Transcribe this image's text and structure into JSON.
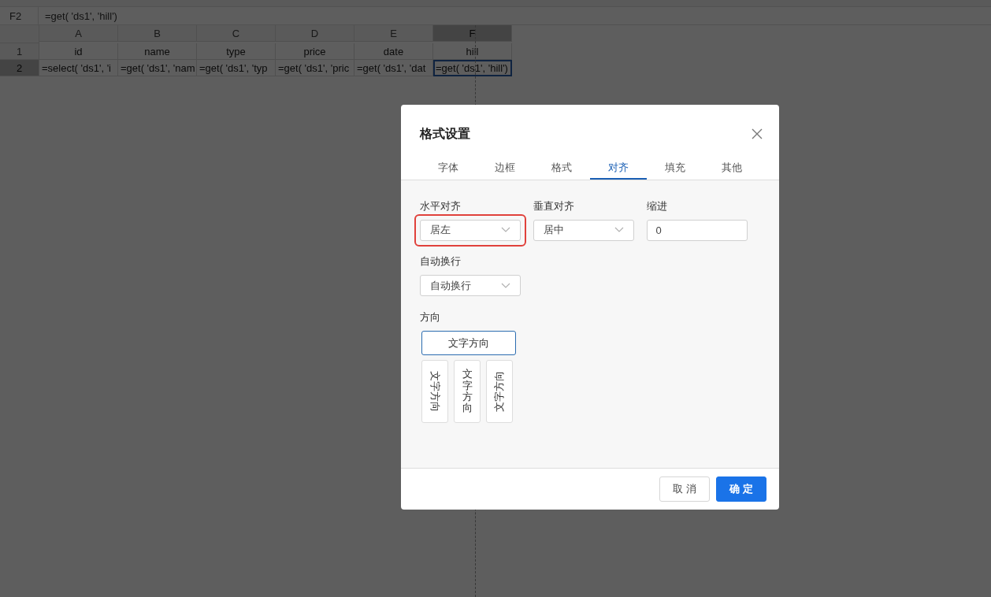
{
  "formula_bar": {
    "cell_ref": "F2",
    "formula": "=get( 'ds1', 'hill')"
  },
  "sheet": {
    "columns": [
      {
        "label": "A",
        "selected": false
      },
      {
        "label": "B",
        "selected": false
      },
      {
        "label": "C",
        "selected": false
      },
      {
        "label": "D",
        "selected": false
      },
      {
        "label": "E",
        "selected": false
      },
      {
        "label": "F",
        "selected": true
      }
    ],
    "rows": [
      {
        "label": "1",
        "selected": false,
        "cells": [
          {
            "text": "id",
            "selected": false
          },
          {
            "text": "name",
            "selected": false
          },
          {
            "text": "type",
            "selected": false
          },
          {
            "text": "price",
            "selected": false
          },
          {
            "text": "date",
            "selected": false
          },
          {
            "text": "hill",
            "selected": false
          }
        ]
      },
      {
        "label": "2",
        "selected": true,
        "cells": [
          {
            "text": "=select( 'ds1', 'i",
            "selected": false
          },
          {
            "text": "=get( 'ds1', 'nam",
            "selected": false
          },
          {
            "text": "=get( 'ds1', 'typ",
            "selected": false
          },
          {
            "text": "=get( 'ds1', 'pric",
            "selected": false
          },
          {
            "text": "=get( 'ds1', 'dat",
            "selected": false
          },
          {
            "text": "=get( 'ds1', 'hill')",
            "selected": true
          }
        ]
      }
    ]
  },
  "dialog": {
    "title": "格式设置",
    "tabs": [
      {
        "label": "字体",
        "selected": false
      },
      {
        "label": "边框",
        "selected": false
      },
      {
        "label": "格式",
        "selected": false
      },
      {
        "label": "对齐",
        "selected": true
      },
      {
        "label": "填充",
        "selected": false
      },
      {
        "label": "其他",
        "selected": false
      }
    ],
    "fields": [
      {
        "label": "水平对齐",
        "kind": "select",
        "value": "居左",
        "highlighted": true
      },
      {
        "label": "垂直对齐",
        "kind": "select",
        "value": "居中",
        "highlighted": false
      },
      {
        "label": "缩进",
        "kind": "input",
        "value": "0",
        "highlighted": false
      }
    ],
    "wrap": {
      "label": "自动换行",
      "value": "自动换行"
    },
    "direction": {
      "label": "方向",
      "options": [
        {
          "kind": "horizontal",
          "text": "文字方向",
          "selected": true
        },
        {
          "kind": "rotate-down",
          "text": "文字方向",
          "selected": false
        },
        {
          "kind": "vertical",
          "text": "文字方向",
          "selected": false
        },
        {
          "kind": "rotate-up",
          "text": "文字方向",
          "selected": false
        }
      ]
    },
    "buttons": [
      {
        "label": "取 消",
        "kind": "secondary"
      },
      {
        "label": "确 定",
        "kind": "primary"
      }
    ]
  }
}
